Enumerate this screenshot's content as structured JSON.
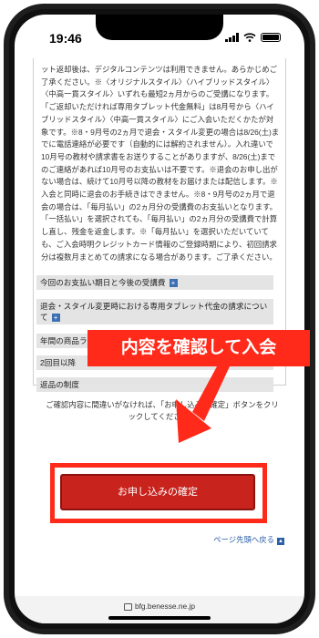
{
  "status": {
    "time": "19:46"
  },
  "content": {
    "paragraph": "ット返却後は、デジタルコンテンツは利用できません。あらかじめご了承ください。※〈オリジナルスタイル〉〈ハイブリッドスタイル〉〈中高一貫スタイル〉いずれも最短2ヵ月からのご受講になります。「ご返却いただければ専用タブレット代金無料」は8月号から〈ハイブリッドスタイル〉〈中高一貫スタイル〉にご入会いただくかたが対象です。※8・9月号の2ヵ月で退会・スタイル変更の場合は8/26(土)までに電話連絡が必要です（自動的には解約されません）。入れ違いで10月号の教材や請求書をお送りすることがありますが、8/26(土)までのご連絡があれば10月号のお支払いは不要です。※退会のお申し出がない場合は、続けて10月号以降の教材をお届けまたは配信します。※入会と同時に退会のお手続きはできません。※8・9月号の2ヵ月で退会の場合は、「毎月払い」の2ヵ月分の受講費のお支払いとなります。「一括払い」を選択されても、「毎月払い」の2ヵ月分の受講費で計算し直し、残金を返金します。※「毎月払い」を選択いただいていても、ご入会時明クレジットカード情報のご登録時期により、初回請求分は複数月まとめての請求になる場合があります。ご了承ください。",
    "accordions": [
      "今回のお支払い期日と今後の受講費",
      "退会・スタイル変更時における専用タブレット代金の請求について",
      "年間の商品ラインナップ",
      "2回目以降",
      "返品の制度"
    ],
    "confirm_text": "ご確認内容に間違いがなければ、「お申し込みの確定」ボタンをクリックしてください。",
    "submit_label": "お申し込みの確定",
    "page_top_label": "ページ先頭へ戻る"
  },
  "browser": {
    "url": "bfg.benesse.ne.jp"
  },
  "annotation": {
    "callout_text": "内容を確認して入会"
  },
  "colors": {
    "accent_red": "#ff2a1a",
    "button_red": "#c8231d",
    "link_blue": "#2b5fa8"
  }
}
